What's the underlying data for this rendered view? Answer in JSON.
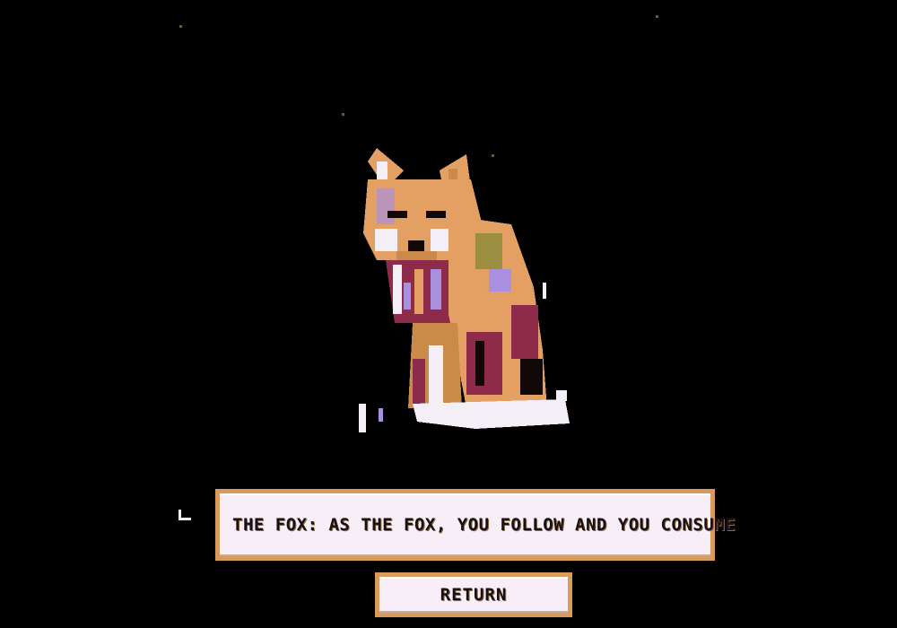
{
  "scene": {
    "image": "fox-icon",
    "palette": {
      "background": "#000000",
      "fox_orange": "#e3a062",
      "fox_dark_orange": "#c98a4a",
      "fox_maroon": "#8e2a4a",
      "fox_lavender": "#a98fe0",
      "fox_white": "#f4eef6",
      "fox_black": "#120808",
      "fox_olive": "#8a8a3a"
    }
  },
  "dialog": {
    "text": "THE FOX: AS THE FOX, YOU FOLLOW AND YOU CONSUME"
  },
  "return_button": {
    "label": "RETURN"
  },
  "colors": {
    "panel_border": "#d99a5b",
    "panel_fill": "#f7eef7",
    "text": "#1a0f14"
  }
}
